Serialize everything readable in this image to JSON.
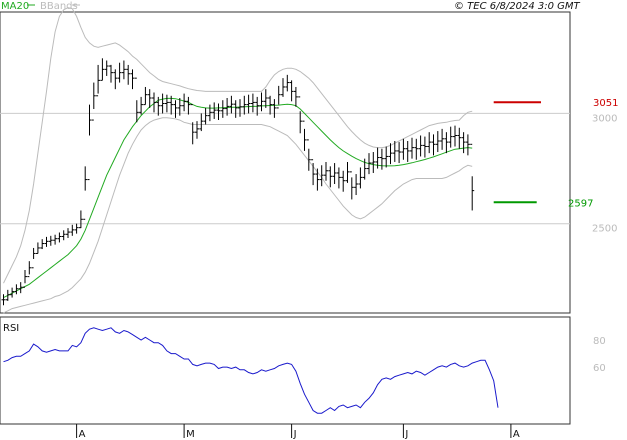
{
  "header": {
    "ma_label": "MA20",
    "bbands_label": "BBands",
    "source_label": "© TEC 6/8/2024 3:0 GMT"
  },
  "colors": {
    "ma": "#22aa22",
    "bbands": "#bbbbbb",
    "price": "#000000",
    "rsi": "#1a1acc",
    "resistance": "#cc0000",
    "support": "#009900",
    "grid": "#cccccc"
  },
  "chart_data": [
    {
      "type": "ohlc",
      "panel": "price",
      "ylim": [
        2095,
        3460
      ],
      "yticks": [
        2500,
        3000
      ],
      "ytick_labels": [
        "2500",
        "3000"
      ],
      "x_labels": [
        "A",
        "M",
        "J",
        "J",
        "A"
      ],
      "x_label_bars": [
        17,
        42,
        67,
        93,
        118
      ],
      "n_bars": 121,
      "close": [
        2155,
        2178,
        2192,
        2205,
        2212,
        2260,
        2300,
        2365,
        2390,
        2410,
        2420,
        2425,
        2432,
        2442,
        2452,
        2462,
        2472,
        2482,
        2520,
        2700,
        2970,
        3080,
        3150,
        3200,
        3215,
        3185,
        3160,
        3185,
        3200,
        3180,
        3160,
        3005,
        3040,
        3085,
        3070,
        3050,
        3035,
        3045,
        3050,
        3040,
        3025,
        3035,
        3055,
        3040,
        2915,
        2930,
        2965,
        2990,
        3005,
        3015,
        3012,
        3022,
        3032,
        3042,
        3025,
        3030,
        3040,
        3045,
        3050,
        3035,
        3055,
        3070,
        3040,
        3025,
        3085,
        3120,
        3140,
        3100,
        3075,
        2965,
        2880,
        2790,
        2725,
        2700,
        2720,
        2740,
        2715,
        2730,
        2710,
        2695,
        2735,
        2665,
        2680,
        2710,
        2750,
        2775,
        2780,
        2800,
        2795,
        2805,
        2820,
        2830,
        2825,
        2840,
        2830,
        2845,
        2840,
        2855,
        2850,
        2870,
        2860,
        2875,
        2885,
        2870,
        2895,
        2900,
        2890,
        2870,
        2860,
        2650
      ],
      "high": [
        2180,
        2200,
        2210,
        2225,
        2235,
        2290,
        2330,
        2390,
        2415,
        2430,
        2440,
        2445,
        2450,
        2460,
        2470,
        2480,
        2495,
        2500,
        2560,
        2760,
        3040,
        3140,
        3220,
        3250,
        3240,
        3220,
        3200,
        3230,
        3240,
        3220,
        3200,
        3060,
        3075,
        3120,
        3110,
        3095,
        3075,
        3090,
        3085,
        3080,
        3060,
        3070,
        3090,
        3075,
        2960,
        2965,
        3000,
        3025,
        3040,
        3050,
        3045,
        3060,
        3070,
        3080,
        3060,
        3065,
        3080,
        3085,
        3090,
        3075,
        3095,
        3110,
        3080,
        3065,
        3125,
        3160,
        3175,
        3150,
        3120,
        3010,
        2930,
        2840,
        2775,
        2750,
        2765,
        2780,
        2760,
        2775,
        2755,
        2740,
        2780,
        2710,
        2725,
        2755,
        2795,
        2820,
        2825,
        2845,
        2840,
        2850,
        2865,
        2875,
        2870,
        2885,
        2875,
        2890,
        2885,
        2900,
        2895,
        2915,
        2905,
        2920,
        2930,
        2915,
        2940,
        2945,
        2935,
        2915,
        2905,
        2715
      ],
      "low": [
        2130,
        2150,
        2165,
        2180,
        2185,
        2230,
        2270,
        2340,
        2365,
        2385,
        2395,
        2400,
        2405,
        2415,
        2425,
        2435,
        2445,
        2455,
        2480,
        2650,
        2900,
        3020,
        3090,
        3150,
        3170,
        3140,
        3110,
        3140,
        3155,
        3130,
        3110,
        2960,
        2995,
        3040,
        3025,
        3005,
        2990,
        3000,
        3005,
        2995,
        2980,
        2990,
        3010,
        2995,
        2860,
        2885,
        2920,
        2950,
        2965,
        2975,
        2970,
        2980,
        2990,
        3000,
        2980,
        2985,
        2995,
        3000,
        3005,
        2990,
        3010,
        3025,
        2995,
        2980,
        3040,
        3075,
        3100,
        3055,
        3030,
        2910,
        2830,
        2740,
        2675,
        2650,
        2670,
        2695,
        2665,
        2680,
        2660,
        2645,
        2685,
        2610,
        2630,
        2660,
        2700,
        2725,
        2730,
        2750,
        2745,
        2755,
        2770,
        2780,
        2775,
        2790,
        2780,
        2795,
        2790,
        2805,
        2800,
        2820,
        2810,
        2825,
        2835,
        2820,
        2845,
        2850,
        2840,
        2820,
        2810,
        2560
      ],
      "ma20": [
        2165,
        2175,
        2185,
        2195,
        2205,
        2215,
        2225,
        2240,
        2255,
        2270,
        2285,
        2300,
        2315,
        2330,
        2345,
        2360,
        2380,
        2400,
        2430,
        2470,
        2520,
        2570,
        2620,
        2670,
        2720,
        2760,
        2800,
        2840,
        2880,
        2910,
        2940,
        2965,
        2990,
        3010,
        3030,
        3045,
        3060,
        3065,
        3068,
        3068,
        3067,
        3062,
        3056,
        3050,
        3040,
        3032,
        3028,
        3025,
        3024,
        3024,
        3025,
        3026,
        3027,
        3028,
        3028,
        3029,
        3030,
        3031,
        3032,
        3033,
        3034,
        3035,
        3036,
        3037,
        3038,
        3040,
        3042,
        3040,
        3035,
        3020,
        3000,
        2980,
        2960,
        2940,
        2920,
        2900,
        2880,
        2862,
        2845,
        2830,
        2818,
        2806,
        2795,
        2786,
        2778,
        2772,
        2768,
        2765,
        2763,
        2762,
        2762,
        2763,
        2765,
        2768,
        2772,
        2776,
        2781,
        2786,
        2791,
        2797,
        2803,
        2810,
        2817,
        2824,
        2831,
        2838,
        2840,
        2843,
        2845,
        2843
      ],
      "bb_upper": [
        2230,
        2270,
        2310,
        2350,
        2400,
        2470,
        2560,
        2680,
        2820,
        2960,
        3100,
        3250,
        3370,
        3440,
        3470,
        3480,
        3475,
        3440,
        3390,
        3345,
        3320,
        3305,
        3300,
        3305,
        3310,
        3315,
        3320,
        3310,
        3295,
        3280,
        3260,
        3245,
        3225,
        3205,
        3185,
        3170,
        3155,
        3145,
        3140,
        3135,
        3130,
        3125,
        3118,
        3112,
        3108,
        3104,
        3102,
        3100,
        3100,
        3100,
        3100,
        3100,
        3100,
        3100,
        3100,
        3100,
        3100,
        3100,
        3100,
        3100,
        3100,
        3120,
        3150,
        3175,
        3190,
        3200,
        3205,
        3205,
        3200,
        3190,
        3175,
        3160,
        3140,
        3115,
        3090,
        3065,
        3040,
        3015,
        2990,
        2965,
        2940,
        2918,
        2898,
        2880,
        2865,
        2855,
        2848,
        2845,
        2845,
        2848,
        2855,
        2865,
        2875,
        2885,
        2895,
        2905,
        2915,
        2925,
        2935,
        2945,
        2950,
        2955,
        2958,
        2960,
        2965,
        2968,
        2970,
        2990,
        3005,
        3010
      ],
      "bb_lower": [
        2095,
        2105,
        2115,
        2120,
        2125,
        2130,
        2135,
        2140,
        2145,
        2150,
        2155,
        2160,
        2170,
        2175,
        2185,
        2195,
        2210,
        2230,
        2250,
        2280,
        2320,
        2370,
        2420,
        2480,
        2540,
        2600,
        2660,
        2720,
        2770,
        2820,
        2860,
        2895,
        2925,
        2945,
        2960,
        2970,
        2975,
        2980,
        2980,
        2978,
        2975,
        2970,
        2960,
        2955,
        2950,
        2950,
        2950,
        2950,
        2950,
        2950,
        2950,
        2950,
        2950,
        2950,
        2950,
        2950,
        2950,
        2950,
        2950,
        2950,
        2950,
        2945,
        2940,
        2930,
        2920,
        2910,
        2900,
        2880,
        2860,
        2835,
        2810,
        2785,
        2760,
        2735,
        2710,
        2680,
        2655,
        2630,
        2605,
        2580,
        2560,
        2540,
        2528,
        2522,
        2530,
        2545,
        2560,
        2575,
        2590,
        2610,
        2630,
        2650,
        2665,
        2680,
        2690,
        2700,
        2705,
        2705,
        2705,
        2705,
        2705,
        2705,
        2705,
        2710,
        2720,
        2730,
        2740,
        2755,
        2765,
        2760
      ],
      "levels": [
        {
          "name": "resistance",
          "value": 3051,
          "label": "3051",
          "color": "#cc0000",
          "from_bar": 114,
          "to_bar": 125
        },
        {
          "name": "support",
          "value": 2597,
          "label": "2597",
          "color": "#009900",
          "from_bar": 114,
          "to_bar": 124
        }
      ],
      "legend": [
        "MA20",
        "BBands"
      ],
      "grid": true
    },
    {
      "type": "line",
      "panel": "rsi",
      "title": "RSI",
      "ylim": [
        18,
        97
      ],
      "yticks": [
        60,
        80
      ],
      "ytick_labels": [
        "60",
        "80"
      ],
      "values": [
        64,
        65,
        67,
        68,
        68,
        70,
        72,
        77,
        75,
        72,
        71,
        72,
        73,
        72,
        72,
        72,
        76,
        75,
        78,
        85,
        88,
        89,
        88,
        87,
        88,
        89,
        86,
        85,
        87,
        86,
        84,
        82,
        80,
        82,
        80,
        78,
        78,
        76,
        72,
        70,
        70,
        68,
        66,
        66,
        62,
        61,
        62,
        63,
        63,
        62,
        59,
        60,
        60,
        59,
        60,
        58,
        58,
        56,
        55,
        56,
        58,
        57,
        58,
        59,
        61,
        62,
        63,
        62,
        57,
        48,
        40,
        34,
        28,
        26,
        26,
        28,
        30,
        28,
        31,
        32,
        30,
        31,
        32,
        30,
        34,
        37,
        41,
        47,
        51,
        52,
        51,
        53,
        54,
        55,
        56,
        55,
        57,
        56,
        54,
        56,
        58,
        60,
        61,
        60,
        62,
        63,
        61,
        60,
        61,
        63,
        64,
        65,
        65,
        58,
        50,
        30
      ],
      "grid": false
    }
  ]
}
